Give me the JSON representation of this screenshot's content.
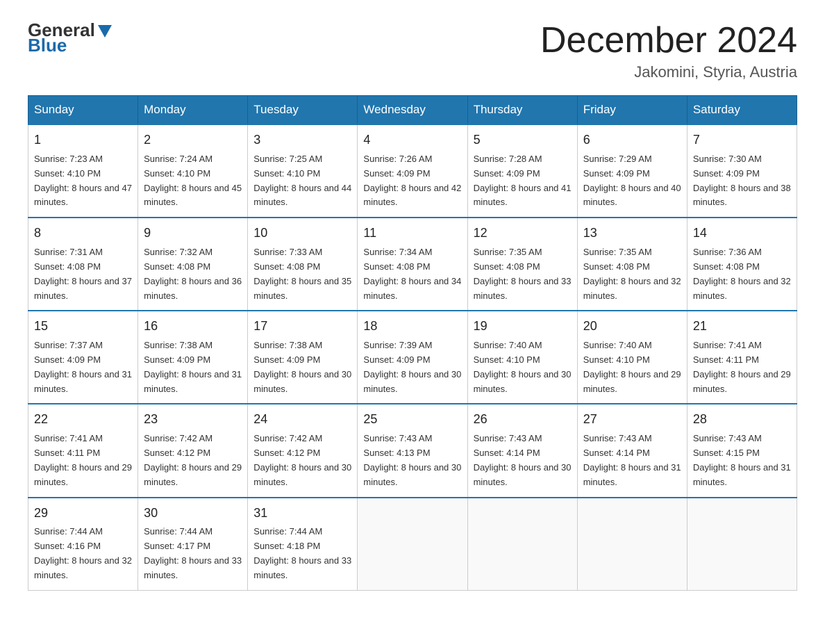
{
  "logo": {
    "part1": "General",
    "part2": "Blue"
  },
  "title": "December 2024",
  "location": "Jakomini, Styria, Austria",
  "weekdays": [
    "Sunday",
    "Monday",
    "Tuesday",
    "Wednesday",
    "Thursday",
    "Friday",
    "Saturday"
  ],
  "weeks": [
    [
      {
        "day": "1",
        "sunrise": "7:23 AM",
        "sunset": "4:10 PM",
        "daylight": "8 hours and 47 minutes."
      },
      {
        "day": "2",
        "sunrise": "7:24 AM",
        "sunset": "4:10 PM",
        "daylight": "8 hours and 45 minutes."
      },
      {
        "day": "3",
        "sunrise": "7:25 AM",
        "sunset": "4:10 PM",
        "daylight": "8 hours and 44 minutes."
      },
      {
        "day": "4",
        "sunrise": "7:26 AM",
        "sunset": "4:09 PM",
        "daylight": "8 hours and 42 minutes."
      },
      {
        "day": "5",
        "sunrise": "7:28 AM",
        "sunset": "4:09 PM",
        "daylight": "8 hours and 41 minutes."
      },
      {
        "day": "6",
        "sunrise": "7:29 AM",
        "sunset": "4:09 PM",
        "daylight": "8 hours and 40 minutes."
      },
      {
        "day": "7",
        "sunrise": "7:30 AM",
        "sunset": "4:09 PM",
        "daylight": "8 hours and 38 minutes."
      }
    ],
    [
      {
        "day": "8",
        "sunrise": "7:31 AM",
        "sunset": "4:08 PM",
        "daylight": "8 hours and 37 minutes."
      },
      {
        "day": "9",
        "sunrise": "7:32 AM",
        "sunset": "4:08 PM",
        "daylight": "8 hours and 36 minutes."
      },
      {
        "day": "10",
        "sunrise": "7:33 AM",
        "sunset": "4:08 PM",
        "daylight": "8 hours and 35 minutes."
      },
      {
        "day": "11",
        "sunrise": "7:34 AM",
        "sunset": "4:08 PM",
        "daylight": "8 hours and 34 minutes."
      },
      {
        "day": "12",
        "sunrise": "7:35 AM",
        "sunset": "4:08 PM",
        "daylight": "8 hours and 33 minutes."
      },
      {
        "day": "13",
        "sunrise": "7:35 AM",
        "sunset": "4:08 PM",
        "daylight": "8 hours and 32 minutes."
      },
      {
        "day": "14",
        "sunrise": "7:36 AM",
        "sunset": "4:08 PM",
        "daylight": "8 hours and 32 minutes."
      }
    ],
    [
      {
        "day": "15",
        "sunrise": "7:37 AM",
        "sunset": "4:09 PM",
        "daylight": "8 hours and 31 minutes."
      },
      {
        "day": "16",
        "sunrise": "7:38 AM",
        "sunset": "4:09 PM",
        "daylight": "8 hours and 31 minutes."
      },
      {
        "day": "17",
        "sunrise": "7:38 AM",
        "sunset": "4:09 PM",
        "daylight": "8 hours and 30 minutes."
      },
      {
        "day": "18",
        "sunrise": "7:39 AM",
        "sunset": "4:09 PM",
        "daylight": "8 hours and 30 minutes."
      },
      {
        "day": "19",
        "sunrise": "7:40 AM",
        "sunset": "4:10 PM",
        "daylight": "8 hours and 30 minutes."
      },
      {
        "day": "20",
        "sunrise": "7:40 AM",
        "sunset": "4:10 PM",
        "daylight": "8 hours and 29 minutes."
      },
      {
        "day": "21",
        "sunrise": "7:41 AM",
        "sunset": "4:11 PM",
        "daylight": "8 hours and 29 minutes."
      }
    ],
    [
      {
        "day": "22",
        "sunrise": "7:41 AM",
        "sunset": "4:11 PM",
        "daylight": "8 hours and 29 minutes."
      },
      {
        "day": "23",
        "sunrise": "7:42 AM",
        "sunset": "4:12 PM",
        "daylight": "8 hours and 29 minutes."
      },
      {
        "day": "24",
        "sunrise": "7:42 AM",
        "sunset": "4:12 PM",
        "daylight": "8 hours and 30 minutes."
      },
      {
        "day": "25",
        "sunrise": "7:43 AM",
        "sunset": "4:13 PM",
        "daylight": "8 hours and 30 minutes."
      },
      {
        "day": "26",
        "sunrise": "7:43 AM",
        "sunset": "4:14 PM",
        "daylight": "8 hours and 30 minutes."
      },
      {
        "day": "27",
        "sunrise": "7:43 AM",
        "sunset": "4:14 PM",
        "daylight": "8 hours and 31 minutes."
      },
      {
        "day": "28",
        "sunrise": "7:43 AM",
        "sunset": "4:15 PM",
        "daylight": "8 hours and 31 minutes."
      }
    ],
    [
      {
        "day": "29",
        "sunrise": "7:44 AM",
        "sunset": "4:16 PM",
        "daylight": "8 hours and 32 minutes."
      },
      {
        "day": "30",
        "sunrise": "7:44 AM",
        "sunset": "4:17 PM",
        "daylight": "8 hours and 33 minutes."
      },
      {
        "day": "31",
        "sunrise": "7:44 AM",
        "sunset": "4:18 PM",
        "daylight": "8 hours and 33 minutes."
      },
      null,
      null,
      null,
      null
    ]
  ]
}
